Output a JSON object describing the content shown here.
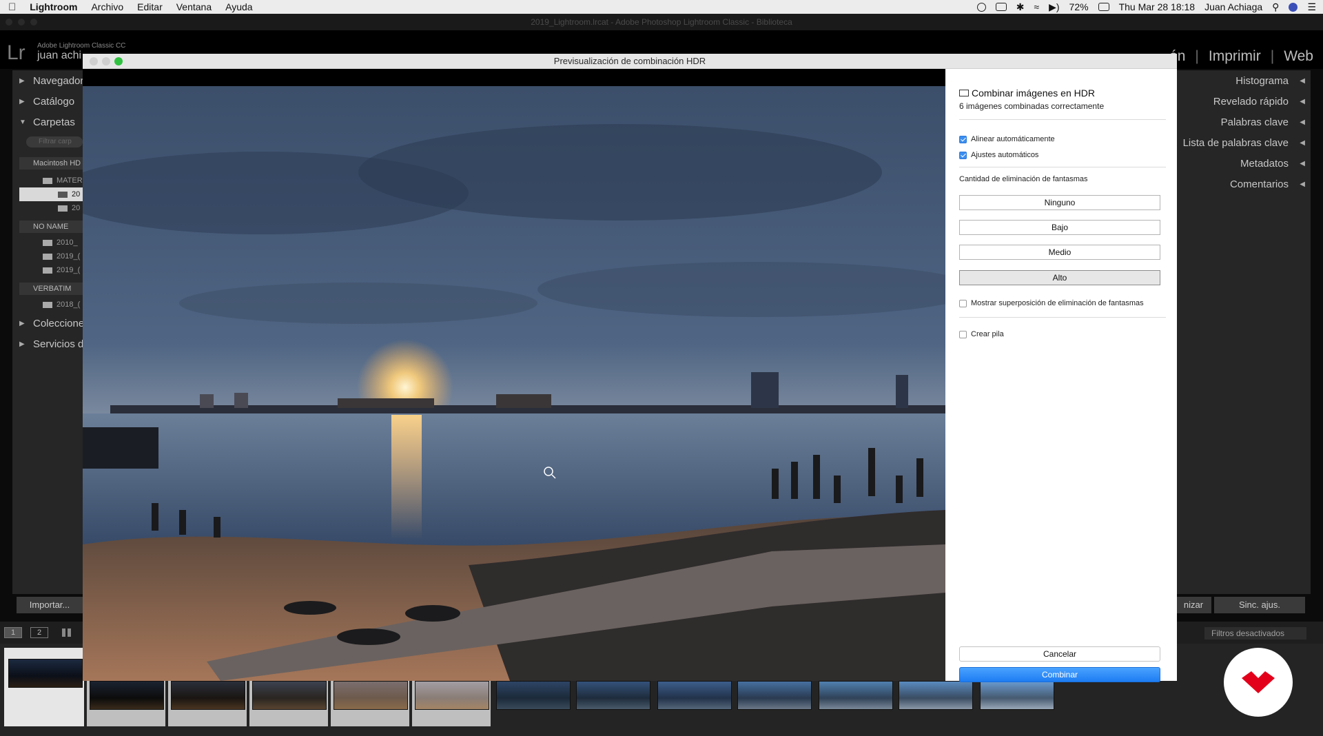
{
  "menubar": {
    "app_name": "Lightroom",
    "menus": [
      "Archivo",
      "Editar",
      "Ventana",
      "Ayuda"
    ],
    "battery": "72%",
    "clock": "Thu Mar 28  18:18",
    "user": "Juan Achiaga"
  },
  "lr_window": {
    "title": "2019_Lightroom.lrcat - Adobe Photoshop Lightroom Classic - Biblioteca",
    "logo": "Lr",
    "product": "Adobe Lightroom Classic CC",
    "user_fragment": "juan achi",
    "modules_visible": [
      "ón",
      "Imprimir",
      "Web"
    ]
  },
  "left_panel": {
    "sections": [
      "Navegador",
      "Catálogo",
      "Carpetas",
      "Coleccione",
      "Servicios d"
    ],
    "filter_placeholder": "Filtrar carp",
    "volumes": [
      "Macintosh HD",
      "NO NAME",
      "VERBATIM"
    ],
    "folders": [
      "MATER",
      "20",
      "20",
      "2010_",
      "2019_(",
      "2019_(",
      "2018_("
    ],
    "import_label": "Importar..."
  },
  "right_panel": {
    "sections": [
      "Histograma",
      "Revelado rápido",
      "Palabras clave",
      "Lista de palabras clave",
      "Metadatos",
      "Comentarios"
    ],
    "sync_label": "Sinc. ajus.",
    "sync2_label": "nizar"
  },
  "filmstrip": {
    "page_buttons": [
      "1",
      "2"
    ],
    "filter_label": "Filtros desactivados"
  },
  "dialog": {
    "title": "Previsualización de combinación HDR",
    "heading": "Combinar imágenes en HDR",
    "status": "6 imágenes combinadas correctamente",
    "auto_align": "Alinear automáticamente",
    "auto_settings": "Ajustes automáticos",
    "deghost_label": "Cantidad de eliminación de fantasmas",
    "deghost_options": [
      "Ninguno",
      "Bajo",
      "Medio",
      "Alto"
    ],
    "deghost_selected": "Alto",
    "show_overlay": "Mostrar superposición de eliminación de fantasmas",
    "create_stack": "Crear pila",
    "cancel_label": "Cancelar",
    "merge_label": "Combinar"
  },
  "colors": {
    "accent": "#1d7cf2",
    "lr_dark": "#262626",
    "watermark_red": "#e3001b"
  }
}
